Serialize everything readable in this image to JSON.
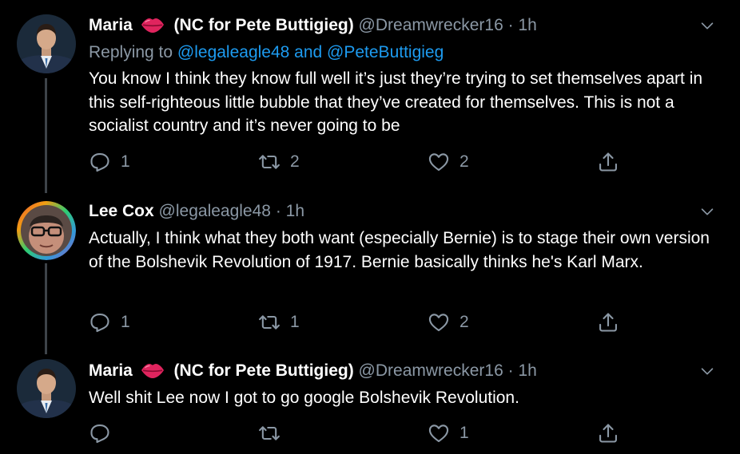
{
  "tweets": [
    {
      "name": "Maria",
      "name_suffix": "(NC for Pete Buttigieg)",
      "handle": "@Dreamwrecker16",
      "separator": "·",
      "time": "1h",
      "replying_prefix": "Replying to",
      "replying_targets": "@legaleagle48 and @PeteButtigieg",
      "text": "You know I think they know full well it’s just they’re trying to set themselves apart in this self-righteous little bubble that they’ve created for themselves. This is not a  socialist country and it’s never going to be",
      "replies": "1",
      "retweets": "2",
      "likes": "2"
    },
    {
      "name": "Lee Cox",
      "handle": "@legaleagle48",
      "separator": "·",
      "time": "1h",
      "text": "Actually, I think what they both want (especially Bernie) is to stage their own version of the Bolshevik Revolution of 1917. Bernie basically thinks he's Karl Marx.",
      "replies": "1",
      "retweets": "1",
      "likes": "2"
    },
    {
      "name": "Maria",
      "name_suffix": "(NC for Pete Buttigieg)",
      "handle": "@Dreamwrecker16",
      "separator": "·",
      "time": "1h",
      "text": "Well shit Lee now I got to go google Bolshevik Revolution.",
      "replies": "",
      "retweets": "",
      "likes": "1"
    }
  ],
  "icons": {
    "reply": "reply-icon",
    "retweet": "retweet-icon",
    "like": "heart-icon",
    "share": "share-icon",
    "more": "chevron-down-icon",
    "emoji": "kiss-mark-icon"
  },
  "colors": {
    "background": "#000000",
    "text": "#ffffff",
    "muted": "#8b98a5",
    "link": "#1d9bf0",
    "thread_line": "#3d4349"
  }
}
